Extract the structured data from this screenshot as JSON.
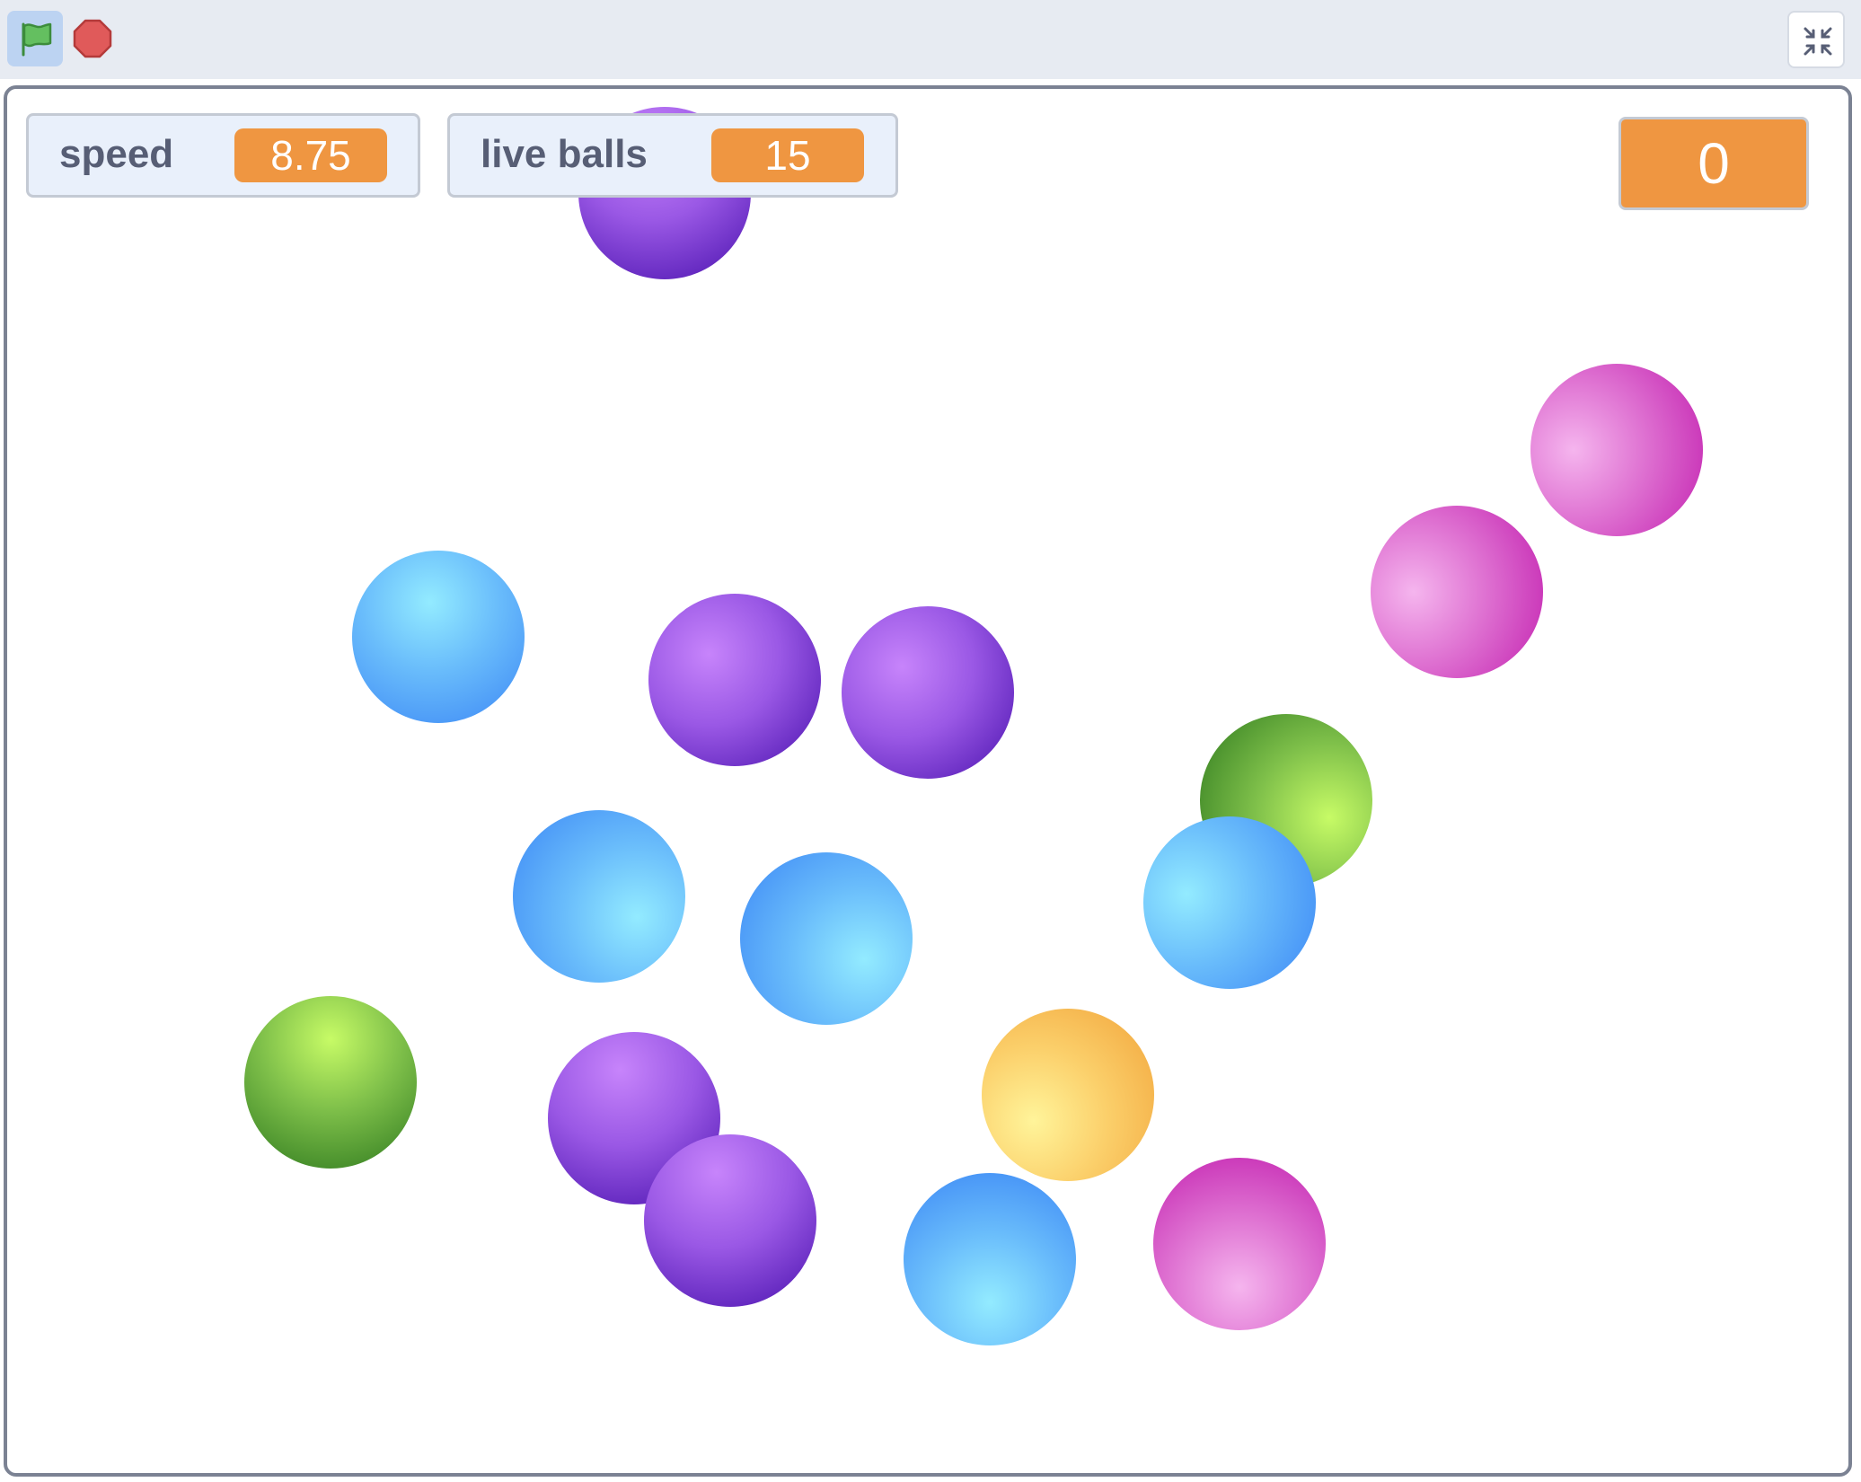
{
  "toolbar": {
    "green_flag_icon": "green-flag-icon",
    "stop_icon": "stop-sign-icon",
    "fullscreen_icon": "exit-fullscreen-icon"
  },
  "monitors": {
    "speed": {
      "label": "speed",
      "value": "8.75"
    },
    "live_balls": {
      "label": "live balls",
      "value": "15"
    },
    "score": {
      "value": "0"
    }
  },
  "colors": {
    "monitor_value": "#ef9641",
    "stage_border": "#7b8293",
    "toolbar_bg": "#e7ebf2",
    "flag_button_bg": "#bcd3f2"
  }
}
